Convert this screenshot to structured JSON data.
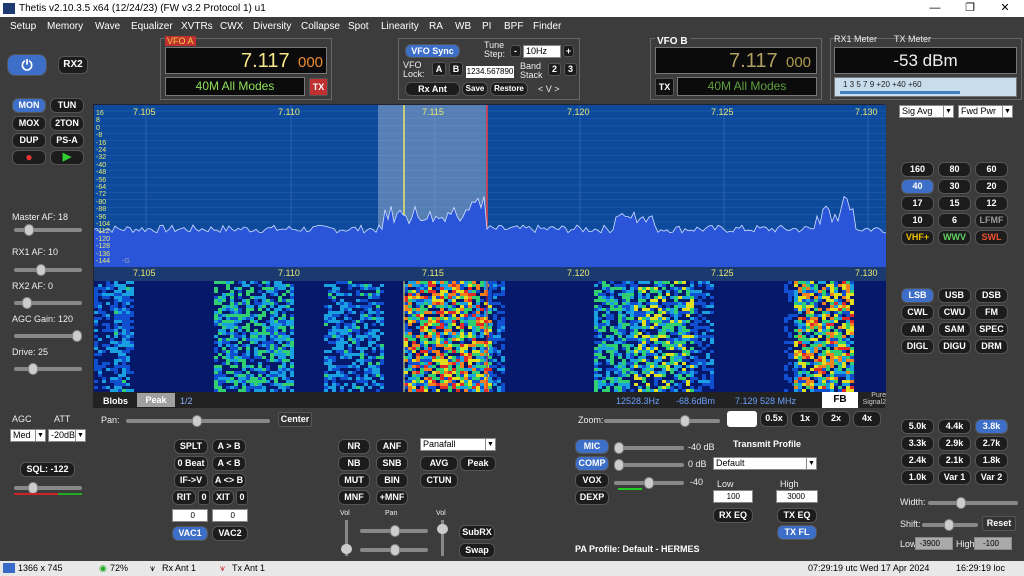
{
  "titlebar": {
    "title": "Thetis v2.10.3.5 x64 (12/24/23) (FW v3.2 Protocol 1) u1",
    "min": "—",
    "max": "❐",
    "close": "✕"
  },
  "menu": [
    "Setup",
    "Memory",
    "Wave",
    "Equalizer",
    "XVTRs",
    "CWX",
    "Diversity",
    "Collapse",
    "Spot",
    "Linearity",
    "RA",
    "WB",
    "PI",
    "BPF",
    "Finder"
  ],
  "left": {
    "power_icon": "power-icon",
    "rx2": "RX2",
    "buttons": [
      "MON",
      "TUN",
      "MOX",
      "2TON",
      "DUP",
      "PS-A"
    ],
    "master_af": "Master AF:  18",
    "rx1_af": "RX1 AF:  10",
    "rx2_af": "RX2 AF:  0",
    "agc_gain": "AGC Gain:  120",
    "drive": "Drive:  25",
    "agc_label": "AGC",
    "att_label": "ATT",
    "agc_value": "Med",
    "att_value": "-20dB",
    "sql": "SQL: -122"
  },
  "vfoa": {
    "label": "VFO A",
    "freq_main": "7.117",
    "freq_sub": "000",
    "mode": "40M All Modes",
    "tx": "TX"
  },
  "vfob": {
    "label": "VFO B",
    "freq_main": "7.117",
    "freq_sub": "000",
    "mode": "40M All Modes",
    "tx": "TX"
  },
  "center": {
    "vfo_sync": "VFO Sync",
    "tune_step_label": "Tune Step:",
    "tune_step": "10Hz",
    "minus": "-",
    "plus": "+",
    "vfo_lock_label": "VFO Lock:",
    "lock_a": "A",
    "lock_b": "B",
    "lock_freq": "1234.567890",
    "band_stack_label": "Band Stack",
    "bs2": "2",
    "bs3": "3",
    "rx_ant": "Rx Ant",
    "save": "Save",
    "restore": "Restore",
    "arrows": "<  V  >"
  },
  "meter": {
    "rx1_label": "RX1 Meter",
    "tx_label": "TX Meter",
    "reading": "-53 dBm",
    "scale": "1   3   5   7   9   +20   +40   +60",
    "sig_avg": "Sig Avg",
    "fwd_pwr": "Fwd Pwr"
  },
  "panadapter": {
    "freq_ticks": [
      "7.105",
      "7.110",
      "7.115",
      "7.120",
      "7.125",
      "7.130"
    ],
    "db_ticks": [
      "16",
      "8",
      "0",
      "-8",
      "-16",
      "-24",
      "-32",
      "-40",
      "-48",
      "-56",
      "-64",
      "-72",
      "-80",
      "-88",
      "-96",
      "-104",
      "-112",
      "-120",
      "-128",
      "-136",
      "-144"
    ],
    "marker": "-G",
    "blobs": "Blobs",
    "peak": "Peak",
    "page": "1/2",
    "readout_hz": "12528.3Hz",
    "readout_dbm": "-68.6dBm",
    "readout_mhz": "7.129 528 MHz",
    "fb": "FB",
    "pure_signal": "Pure Signal2",
    "colors": {
      "bg": "#0a3a8a",
      "signal": "#2a55d8",
      "filter": "#b0c0d8"
    }
  },
  "bands": [
    "160",
    "80",
    "60",
    "40",
    "30",
    "20",
    "17",
    "15",
    "12",
    "10",
    "6",
    "LFMF",
    "VHF+",
    "WWV",
    "SWL"
  ],
  "modes": [
    "LSB",
    "USB",
    "DSB",
    "CWL",
    "CWU",
    "FM",
    "AM",
    "SAM",
    "SPEC",
    "DIGL",
    "DIGU",
    "DRM"
  ],
  "filters": [
    "5.0k",
    "4.4k",
    "3.8k",
    "3.3k",
    "2.9k",
    "2.7k",
    "2.4k",
    "2.1k",
    "1.8k",
    "1.0k",
    "Var 1",
    "Var 2"
  ],
  "filter_ctrl": {
    "width": "Width:",
    "shift": "Shift:",
    "reset": "Reset",
    "low_label": "Low",
    "low": "-3900",
    "high_label": "High",
    "high": "-100"
  },
  "bottom": {
    "pan": "Pan:",
    "center": "Center",
    "zoom": "Zoom:",
    "zoom_btns": [
      "0.5x",
      "1x",
      "2x",
      "4x"
    ],
    "split": "SPLT",
    "a_to_b": "A > B",
    "zero_beat": "0 Beat",
    "a_from_b": "A < B",
    "if_v": "IF->V",
    "a_swap_b": "A <> B",
    "rit": "RIT",
    "rit_val": "0",
    "xit": "XIT",
    "xit_val": "0",
    "rit_num": "0",
    "xit_num": "0",
    "vac1": "VAC1",
    "vac2": "VAC2",
    "dsp": [
      "NR",
      "ANF",
      "NB",
      "SNB",
      "MUT",
      "BIN",
      "MNF",
      "+MNF"
    ],
    "display_mode": "Panafall",
    "avg": "AVG",
    "peak": "Peak",
    "ctun": "CTUN",
    "vol1": "Vol",
    "pan2": "Pan",
    "vol2": "Vol",
    "subrx": "SubRX",
    "swap": "Swap",
    "mic": "MIC",
    "mic_val": "-40 dB",
    "comp": "COMP",
    "comp_val": "0 dB",
    "vox": "VOX",
    "vox_val": "-40",
    "dexp": "DEXP",
    "tx_profile_label": "Transmit Profile",
    "tx_profile": "Default",
    "low_label": "Low",
    "low_val": "100",
    "high_label": "High",
    "high_val": "3000",
    "rx_eq": "RX EQ",
    "tx_eq": "TX EQ",
    "tx_fl": "TX FL",
    "pa_profile": "PA Profile: Default - HERMES"
  },
  "status": {
    "res": "1366 x 745",
    "cpu": "72%",
    "rx_ant": "Rx Ant  1",
    "tx_ant": "Tx Ant  1",
    "utc": "07:29:19 utc  Wed 17 Apr 2024",
    "loc": "16:29:19 loc"
  }
}
